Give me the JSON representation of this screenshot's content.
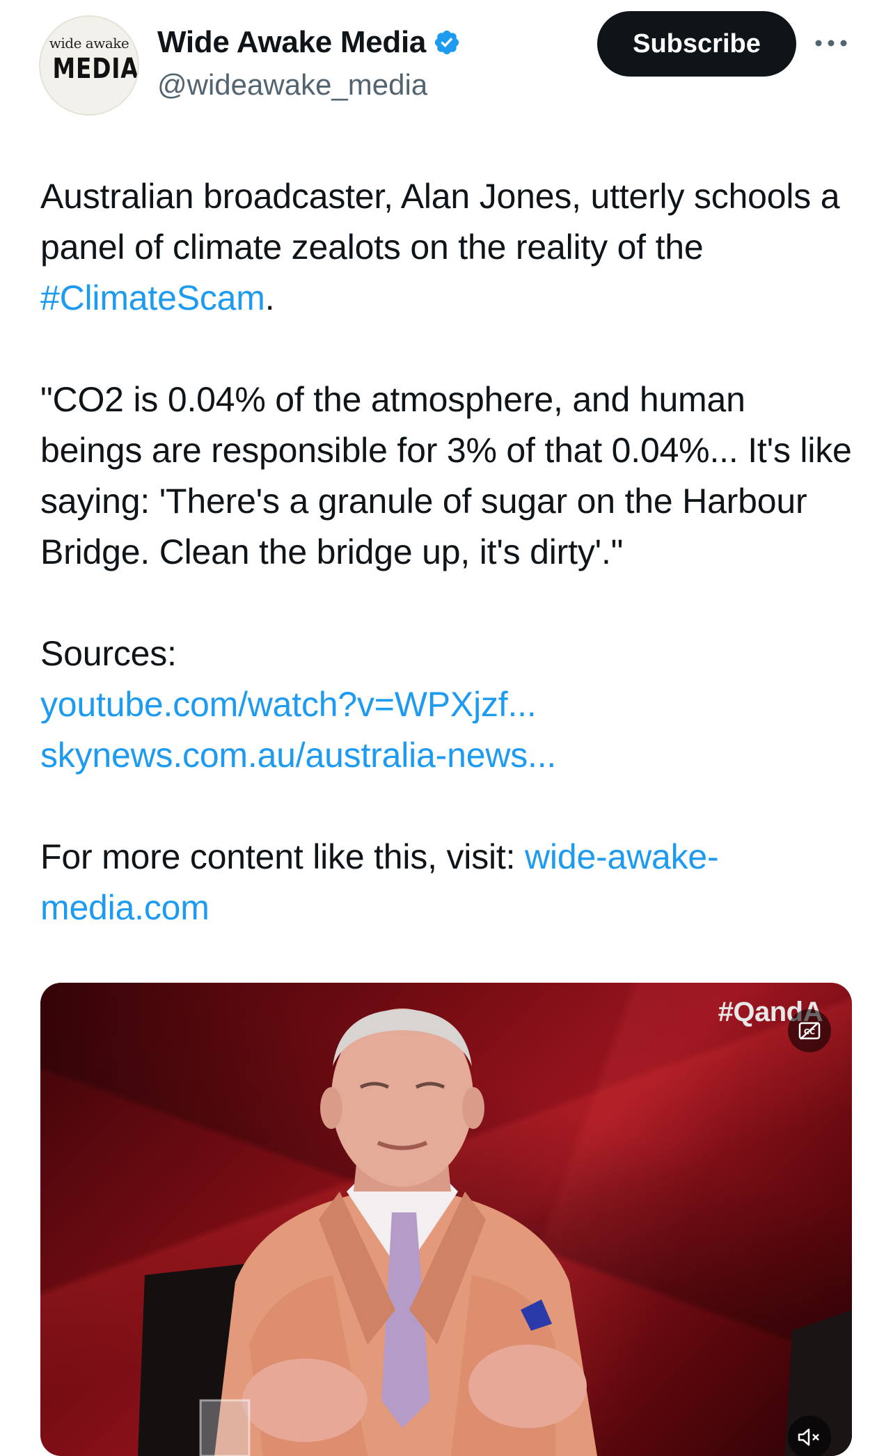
{
  "account": {
    "avatar_line1": "wide awake",
    "avatar_line2": "MEDIA",
    "name": "Wide Awake Media",
    "handle": "@wideawake_media",
    "verified": true
  },
  "actions": {
    "subscribe_label": "Subscribe",
    "more_icon": "more-horizontal-icon"
  },
  "tweet": {
    "p1_before": "Australian broadcaster, Alan Jones, utterly schools a panel of climate zealots on the reality of the ",
    "p1_hashtag": "#ClimateScam",
    "p1_after": ".",
    "quote": "\"CO2 is 0.04% of the atmosphere, and human beings are responsible for 3% of that 0.04%... It's like saying: 'There's a granule of sugar on the Harbour Bridge. Clean the bridge up, it's dirty'.\"",
    "sources_label": "Sources:",
    "source_link1": "youtube.com/watch?v=WPXjzf...",
    "source_link2": "skynews.com.au/australia-news...",
    "more_before": "For more content like this, visit: ",
    "more_link": "wide-awake-media.com"
  },
  "video": {
    "overlay_hashtag": "#QandA",
    "cc_icon": "closed-captions-off-icon",
    "mute_icon": "muted-speaker-icon"
  },
  "colors": {
    "link": "#1d9bf0",
    "text": "#0f1419",
    "secondary": "#536471",
    "button_bg": "#0f1419",
    "verified": "#1d9bf0"
  }
}
